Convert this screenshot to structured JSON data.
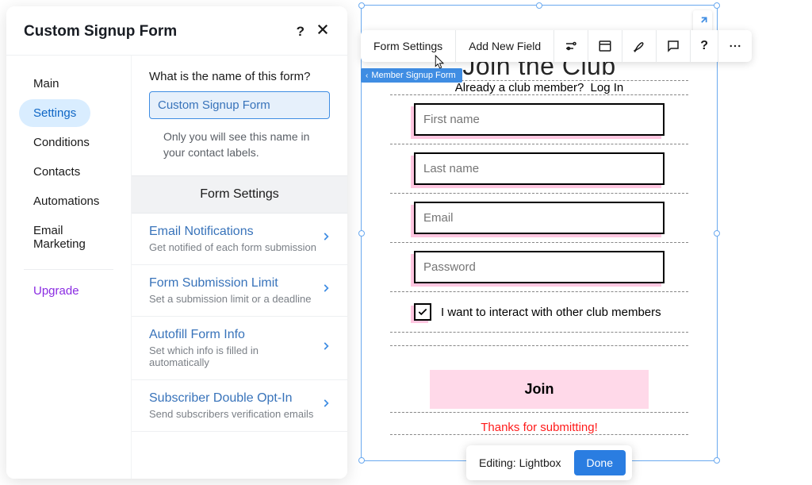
{
  "panel": {
    "title": "Custom Signup Form",
    "help": "?"
  },
  "sidebar": {
    "items": [
      {
        "label": "Main"
      },
      {
        "label": "Settings"
      },
      {
        "label": "Conditions"
      },
      {
        "label": "Contacts"
      },
      {
        "label": "Automations"
      },
      {
        "label": "Email Marketing"
      }
    ],
    "upgrade": "Upgrade"
  },
  "nameBlock": {
    "label": "What is the name of this form?",
    "value": "Custom Signup Form",
    "help": "Only you will see this name in your contact labels."
  },
  "sectionHeader": "Form Settings",
  "settings": [
    {
      "title": "Email Notifications",
      "sub": "Get notified of each form submission"
    },
    {
      "title": "Form Submission Limit",
      "sub": "Set a submission limit or a deadline"
    },
    {
      "title": "Autofill Form Info",
      "sub": "Set which info is filled in automatically"
    },
    {
      "title": "Subscriber Double Opt-In",
      "sub": "Send subscribers verification emails"
    }
  ],
  "toolbar": {
    "formSettings": "Form Settings",
    "addNewField": "Add New Field",
    "help": "?"
  },
  "breadcrumb": "Member Signup Form",
  "formPreview": {
    "title": "Join the Club",
    "subPrefix": "Already a club member?",
    "subLink": "Log In",
    "fields": [
      {
        "placeholder": "First name"
      },
      {
        "placeholder": "Last name"
      },
      {
        "placeholder": "Email"
      },
      {
        "placeholder": "Password"
      }
    ],
    "checkboxLabel": "I want to interact with other club members",
    "joinLabel": "Join",
    "thanks": "Thanks for submitting!"
  },
  "editingBar": {
    "label": "Editing: Lightbox",
    "done": "Done"
  }
}
